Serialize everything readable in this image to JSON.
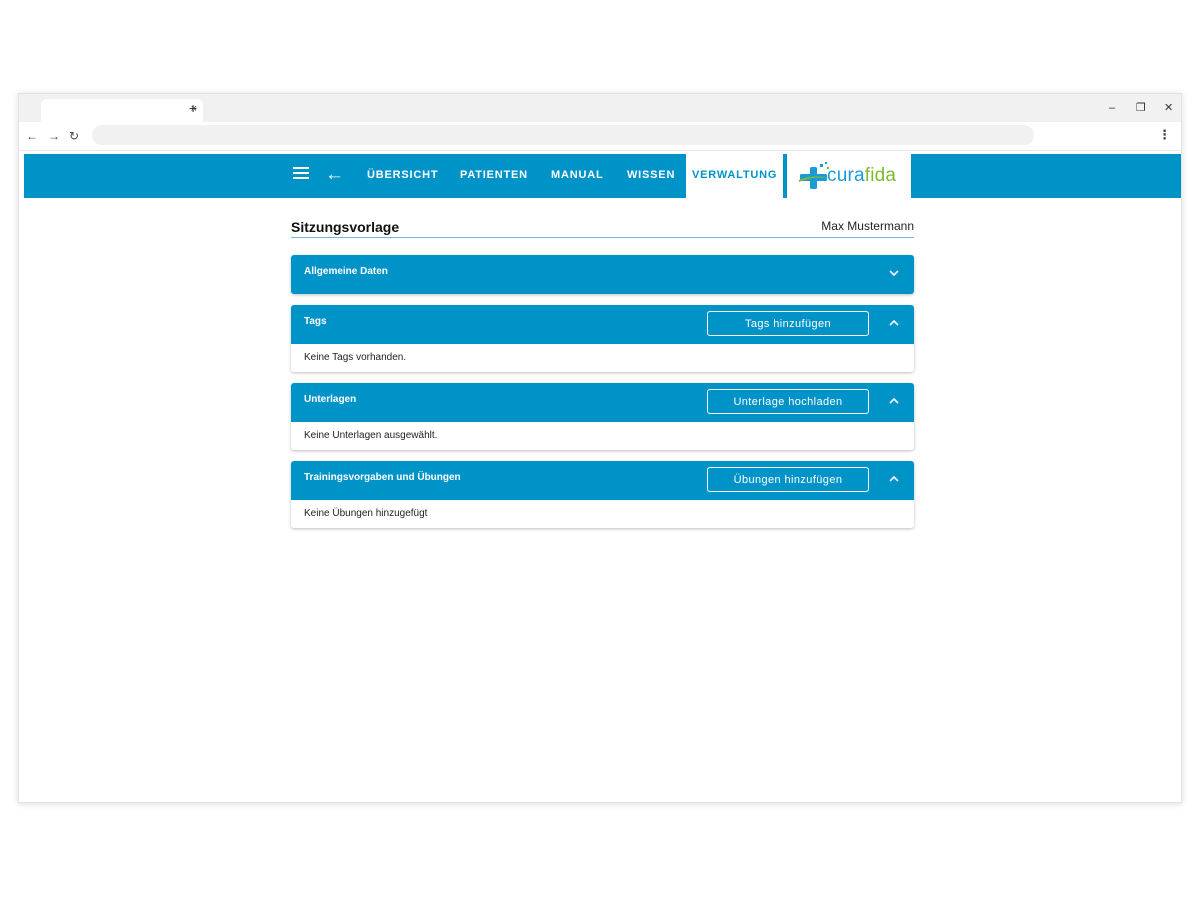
{
  "browser": {
    "tab_close": "×",
    "new_tab": "+",
    "window_controls": {
      "minimize": "–",
      "restore": "❐",
      "close": "✕"
    },
    "nav": {
      "back": "←",
      "forward": "→",
      "reload": "↻"
    },
    "menu": "⋮"
  },
  "appbar": {
    "back_icon": "←",
    "nav_items": [
      "ÜBERSICHT",
      "PATIENTEN",
      "MANUAL",
      "WISSEN",
      "VERWALTUNG"
    ],
    "active_item": "VERWALTUNG",
    "logo": {
      "part1": "cura",
      "part2": "fida"
    },
    "colors": {
      "primary": "#0093c8",
      "logo_blue": "#1a9bd7",
      "logo_green": "#7dbb2c"
    }
  },
  "page": {
    "title": "Sitzungsvorlage",
    "user": "Max Mustermann"
  },
  "panels": [
    {
      "title": "Allgemeine Daten",
      "expanded": false
    },
    {
      "title": "Tags",
      "button": "Tags hinzufügen",
      "body": "Keine Tags vorhanden.",
      "expanded": true
    },
    {
      "title": "Unterlagen",
      "button": "Unterlage hochladen",
      "body": "Keine Unterlagen ausgewählt.",
      "expanded": true
    },
    {
      "title": "Trainingsvorgaben und Übungen",
      "button": "Übungen hinzufügen",
      "body": "Keine Übungen hinzugefügt",
      "expanded": true
    }
  ]
}
